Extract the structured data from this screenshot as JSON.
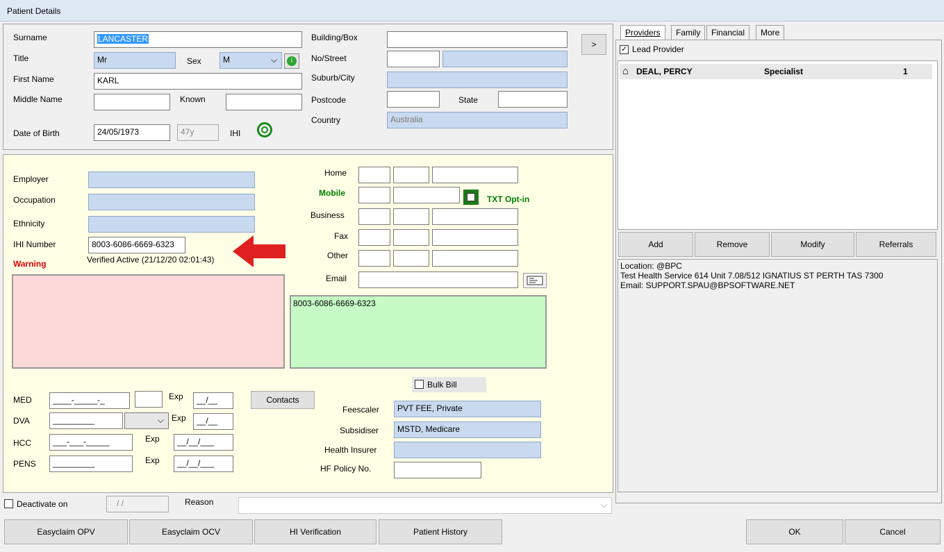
{
  "window": {
    "title": "Patient Details"
  },
  "patient": {
    "surname_label": "Surname",
    "surname": "LANCASTER",
    "title_label": "Title",
    "title": "Mr",
    "sex_label": "Sex",
    "sex": "M",
    "first_name_label": "First Name",
    "first_name": "KARL",
    "middle_name_label": "Middle Name",
    "middle_name": "",
    "known_label": "Known",
    "known": "",
    "dob_label": "Date of Birth",
    "dob": "24/05/1973",
    "age": "47y",
    "ihi_label": "IHI"
  },
  "address": {
    "building_label": "Building/Box",
    "building": "",
    "street_label": "No/Street",
    "street_no": "",
    "street": "",
    "suburb_label": "Suburb/City",
    "suburb": "",
    "postcode_label": "Postcode",
    "postcode": "",
    "state_label": "State",
    "state": "",
    "country_label": "Country",
    "country": "Australia",
    "more_button": ">"
  },
  "details": {
    "employer_label": "Employer",
    "employer": "",
    "occupation_label": "Occupation",
    "occupation": "",
    "ethnicity_label": "Ethnicity",
    "ethnicity": "",
    "ihi_number_label": "IHI Number",
    "ihi_number": "8003-6086-6669-6323",
    "warning_label": "Warning",
    "ihi_status": "Verified Active (21/12/20 02:01:43)",
    "notes_text": "8003-6086-6669-6323"
  },
  "phones": {
    "home_label": "Home",
    "mobile_label": "Mobile",
    "txt_optin_label": "TXT Opt-in",
    "business_label": "Business",
    "fax_label": "Fax",
    "other_label": "Other",
    "email_label": "Email",
    "email": ""
  },
  "cards": {
    "med_label": "MED",
    "med_value": "____-_____-_",
    "med_exp": "__/__",
    "dva_label": "DVA",
    "dva_value": "_________",
    "dva_exp": "__/__",
    "hcc_label": "HCC",
    "hcc_value": "___-___-_____",
    "hcc_exp": "__/__/___",
    "pens_label": "PENS",
    "pens_value": "_________",
    "pens_exp": "__/__/___",
    "exp_label": "Exp",
    "contacts_button": "Contacts"
  },
  "billing": {
    "bulk_bill_label": "Bulk Bill",
    "feescaler_label": "Feescaler",
    "feescaler": "PVT FEE, Private",
    "subsidiser_label": "Subsidiser",
    "subsidiser": "MSTD, Medicare",
    "health_insurer_label": "Health Insurer",
    "health_insurer": "",
    "hf_policy_label": "HF Policy No.",
    "hf_policy": ""
  },
  "deactivate": {
    "label": "Deactivate on",
    "date": "/ /",
    "reason_label": "Reason",
    "reason": ""
  },
  "right_panel": {
    "tabs": [
      "Providers",
      "Family",
      "Financial",
      "More"
    ],
    "lead_provider_label": "Lead Provider",
    "providers": [
      {
        "name": "DEAL, PERCY",
        "role": "Specialist",
        "count": "1"
      }
    ],
    "buttons": [
      "Add",
      "Remove",
      "Modify",
      "Referrals"
    ],
    "info_lines": [
      "Location: @BPC",
      "Test Health Service 614 Unit 7.08/512 IGNATIUS ST PERTH TAS 7300",
      "Email: SUPPORT.SPAU@BPSOFTWARE.NET"
    ]
  },
  "footer": {
    "easyclaim_opv": "Easyclaim OPV",
    "easyclaim_ocv": "Easyclaim OCV",
    "hi_verification": "HI Verification",
    "patient_history": "Patient History",
    "ok": "OK",
    "cancel": "Cancel"
  },
  "colors": {
    "notes_green": "#c6fbc6",
    "warning_pink": "#fdd9d9",
    "form_yellow": "#ffffe6",
    "arrow_red": "#e02020",
    "txt_green": "#008000"
  }
}
